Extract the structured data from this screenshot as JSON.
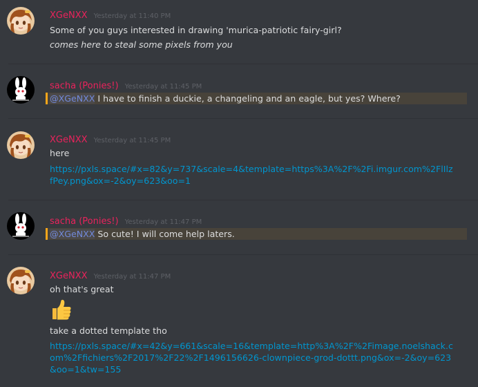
{
  "messages": [
    {
      "author": "XGeNXX",
      "timestamp": "Yesterday at 11:40 PM",
      "lines": [
        "Some of you guys interested in drawing 'murica-patriotic fairy-girl?",
        "comes here to steal some pixels from you"
      ]
    },
    {
      "author": "sacha (Ponies!)",
      "timestamp": "Yesterday at 11:45 PM",
      "mention": "@XGeNXX",
      "text": " I have to finish a duckie, a changeling and an eagle, but yes? Where?"
    },
    {
      "author": "XGeNXX",
      "timestamp": "Yesterday at 11:45 PM",
      "text": "here",
      "link": "https://pxls.space/#x=82&y=737&scale=4&template=https%3A%2F%2Fi.imgur.com%2FlIlzfPey.png&ox=-2&oy=623&oo=1"
    },
    {
      "author": "sacha (Ponies!)",
      "timestamp": "Yesterday at 11:47 PM",
      "mention": "@XGeNXX",
      "text": " So cute! I will come help laters."
    },
    {
      "author": "XGeNXX",
      "timestamp": "Yesterday at 11:47 PM",
      "text": "oh that's great",
      "emoji": "thumbs-up",
      "text2": "take a dotted template tho",
      "link": "https://pxls.space/#x=42&y=661&scale=16&template=http%3A%2F%2Fimage.noelshack.com%2Ffichiers%2F2017%2F22%2F1496156626-clownpiece-grod-dottt.png&ox=-2&oy=623&oo=1&tw=155"
    }
  ],
  "colors": {
    "background": "#36393e",
    "username": "#e9235c",
    "timestamp": "#5e6167",
    "link": "#0096cf",
    "mention": "#7289da",
    "mention_highlight": "#48433a",
    "mention_bar": "#faa61a"
  }
}
